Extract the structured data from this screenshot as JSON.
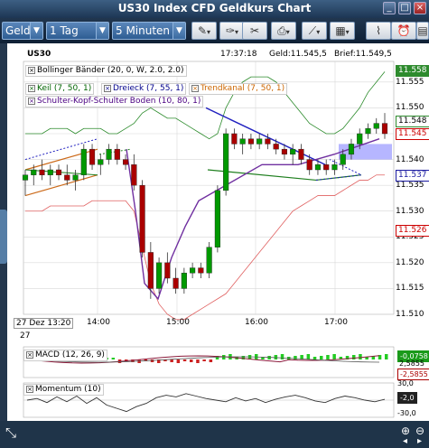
{
  "window": {
    "title": "US30 Index CFD Geldkurs Chart",
    "buttons": [
      "_",
      "□",
      "×"
    ]
  },
  "toolbar": {
    "price_type": "Geld",
    "period": "1 Tag",
    "interval": "5 Minuten"
  },
  "header": {
    "symbol": "US30",
    "time": "17:37:18",
    "bid": "Geld:11.545,5",
    "ask": "Brief:11.549,5"
  },
  "indicators": [
    {
      "label": "Bollinger Bänder (20, 0, W, 2.0, 2.0)",
      "color": "#000000"
    },
    {
      "label": "Keil (7, 50, 1)",
      "color": "#006400"
    },
    {
      "label": "Dreieck (7, 55, 1)",
      "color": "#00008b"
    },
    {
      "label": "Trendkanal (7, 50, 1)",
      "color": "#cc6600"
    },
    {
      "label": "Schulter-Kopf-Schulter Boden (10, 80, 1)",
      "color": "#4b0082"
    }
  ],
  "price_axis": {
    "ticks": [
      "11.555",
      "11.550",
      "11.545",
      "11.540",
      "11.535",
      "11.530",
      "11.525",
      "11.520",
      "11.515",
      "11.510"
    ],
    "tags": [
      {
        "label": "11.558",
        "color": "#2e8b2e"
      },
      {
        "label": "11.548",
        "color": "#2e8b2e"
      },
      {
        "label": "11.545",
        "color": "#cc0000"
      },
      {
        "label": "11.537",
        "color": "#1a1aa0"
      },
      {
        "label": "11.526",
        "color": "#cc0000"
      }
    ]
  },
  "time_axis": {
    "date_label": "27 Dez 13:20",
    "date_sub": "27",
    "ticks": [
      "14:00",
      "15:00",
      "16:00",
      "17:00"
    ]
  },
  "macd": {
    "label": "MACD (12, 26, 9)",
    "tags": [
      "-0,0758",
      "-2,5855"
    ],
    "ticks": [
      "2,5855"
    ]
  },
  "momentum": {
    "label": "Momentum (10)",
    "ticks": [
      "30,0",
      "-30,0",
      "-2,0"
    ]
  },
  "chart_data": [
    {
      "type": "candlestick",
      "title": "US30 Index CFD Geldkurs Chart",
      "ylim": [
        11510,
        11559
      ],
      "x_ticks": [
        "14:00",
        "15:00",
        "16:00",
        "17:00"
      ],
      "colors": {
        "up": "#009900",
        "down": "#aa0000",
        "bollinger": "#2a8a2a",
        "bollinger_lower": "#e06060",
        "hs": "#7030a0",
        "triangle": "#1f1fbf",
        "wedge": "#1f7f1f",
        "channel": "#cc6a1a",
        "highlight": "#7a7aff"
      },
      "candles": [
        {
          "o": 11536,
          "h": 11538,
          "l": 11533,
          "c": 11537
        },
        {
          "o": 11537,
          "h": 11539,
          "l": 11535,
          "c": 11538
        },
        {
          "o": 11538,
          "h": 11540,
          "l": 11536,
          "c": 11537
        },
        {
          "o": 11537,
          "h": 11539,
          "l": 11535,
          "c": 11538
        },
        {
          "o": 11538,
          "h": 11539,
          "l": 11536,
          "c": 11537
        },
        {
          "o": 11537,
          "h": 11539,
          "l": 11535,
          "c": 11536
        },
        {
          "o": 11536,
          "h": 11538,
          "l": 11534,
          "c": 11537
        },
        {
          "o": 11537,
          "h": 11543,
          "l": 11536,
          "c": 11542
        },
        {
          "o": 11542,
          "h": 11543,
          "l": 11538,
          "c": 11539
        },
        {
          "o": 11539,
          "h": 11541,
          "l": 11537,
          "c": 11540
        },
        {
          "o": 11540,
          "h": 11543,
          "l": 11539,
          "c": 11542
        },
        {
          "o": 11542,
          "h": 11543,
          "l": 11539,
          "c": 11540
        },
        {
          "o": 11540,
          "h": 11541,
          "l": 11538,
          "c": 11539
        },
        {
          "o": 11539,
          "h": 11541,
          "l": 11534,
          "c": 11535
        },
        {
          "o": 11535,
          "h": 11536,
          "l": 11521,
          "c": 11522
        },
        {
          "o": 11522,
          "h": 11524,
          "l": 11513,
          "c": 11515
        },
        {
          "o": 11515,
          "h": 11521,
          "l": 11514,
          "c": 11520
        },
        {
          "o": 11520,
          "h": 11522,
          "l": 11516,
          "c": 11517
        },
        {
          "o": 11517,
          "h": 11519,
          "l": 11514,
          "c": 11515
        },
        {
          "o": 11515,
          "h": 11519,
          "l": 11514,
          "c": 11518
        },
        {
          "o": 11518,
          "h": 11520,
          "l": 11517,
          "c": 11519
        },
        {
          "o": 11519,
          "h": 11520,
          "l": 11517,
          "c": 11518
        },
        {
          "o": 11518,
          "h": 11524,
          "l": 11517,
          "c": 11523
        },
        {
          "o": 11523,
          "h": 11535,
          "l": 11522,
          "c": 11534
        },
        {
          "o": 11534,
          "h": 11546,
          "l": 11533,
          "c": 11545
        },
        {
          "o": 11545,
          "h": 11546,
          "l": 11542,
          "c": 11543
        },
        {
          "o": 11543,
          "h": 11545,
          "l": 11541,
          "c": 11544
        },
        {
          "o": 11544,
          "h": 11545,
          "l": 11542,
          "c": 11543
        },
        {
          "o": 11543,
          "h": 11545,
          "l": 11542,
          "c": 11544
        },
        {
          "o": 11544,
          "h": 11545,
          "l": 11542,
          "c": 11543
        },
        {
          "o": 11543,
          "h": 11544,
          "l": 11541,
          "c": 11542
        },
        {
          "o": 11542,
          "h": 11543,
          "l": 11540,
          "c": 11541
        },
        {
          "o": 11541,
          "h": 11543,
          "l": 11539,
          "c": 11542
        },
        {
          "o": 11542,
          "h": 11543,
          "l": 11539,
          "c": 11540
        },
        {
          "o": 11540,
          "h": 11541,
          "l": 11537,
          "c": 11538
        },
        {
          "o": 11538,
          "h": 11540,
          "l": 11537,
          "c": 11539
        },
        {
          "o": 11539,
          "h": 11540,
          "l": 11537,
          "c": 11538
        },
        {
          "o": 11538,
          "h": 11540,
          "l": 11537,
          "c": 11539
        },
        {
          "o": 11539,
          "h": 11542,
          "l": 11538,
          "c": 11541
        },
        {
          "o": 11541,
          "h": 11544,
          "l": 11540,
          "c": 11543
        },
        {
          "o": 11543,
          "h": 11546,
          "l": 11542,
          "c": 11545
        },
        {
          "o": 11545,
          "h": 11547,
          "l": 11544,
          "c": 11546
        },
        {
          "o": 11546,
          "h": 11548,
          "l": 11545,
          "c": 11547
        },
        {
          "o": 11547,
          "h": 11549,
          "l": 11544,
          "c": 11545
        }
      ],
      "bollinger_upper": [
        11545,
        11545,
        11545,
        11546,
        11546,
        11546,
        11545,
        11546,
        11546,
        11546,
        11545,
        11545,
        11546,
        11547,
        11549,
        11550,
        11549,
        11548,
        11548,
        11547,
        11546,
        11545,
        11544,
        11545,
        11550,
        11553,
        11555,
        11556,
        11556,
        11556,
        11555,
        11553,
        11551,
        11549,
        11547,
        11546,
        11545,
        11545,
        11546,
        11548,
        11550,
        11553,
        11555,
        11557
      ],
      "bollinger_lower": [
        11530,
        11530,
        11530,
        11531,
        11531,
        11531,
        11531,
        11531,
        11532,
        11532,
        11532,
        11532,
        11532,
        11530,
        11523,
        11516,
        11512,
        11510,
        11509,
        11509,
        11510,
        11511,
        11512,
        11513,
        11514,
        11516,
        11518,
        11520,
        11522,
        11524,
        11526,
        11528,
        11530,
        11531,
        11532,
        11533,
        11533,
        11533,
        11534,
        11535,
        11536,
        11536,
        11537,
        11537
      ]
    },
    {
      "type": "bar",
      "title": "MACD (12, 26, 9)",
      "ylim": [
        -2.5855,
        0.5
      ]
    },
    {
      "type": "line",
      "title": "Momentum (10)",
      "ylim": [
        -30,
        30
      ]
    }
  ]
}
